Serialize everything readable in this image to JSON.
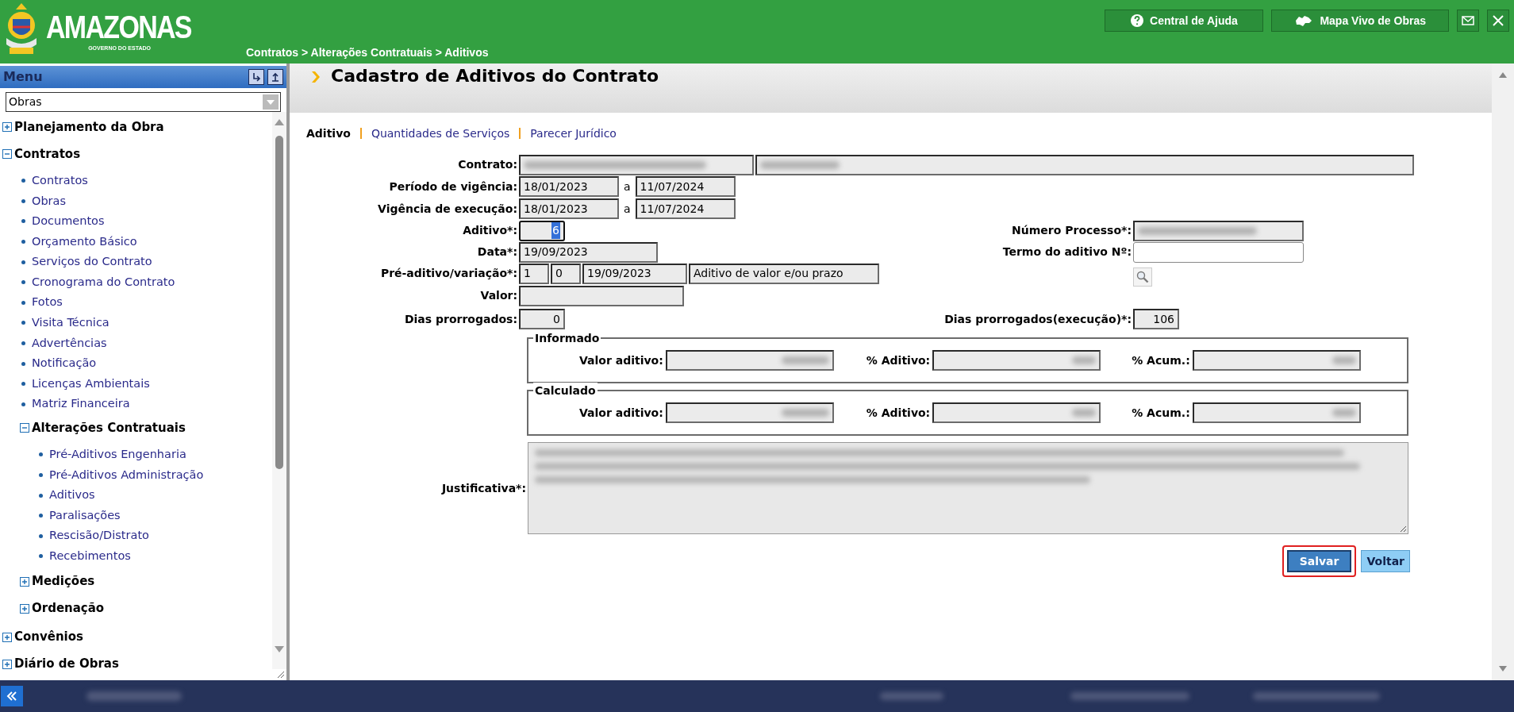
{
  "header": {
    "brand": "AMAZONAS",
    "subtitle": "GOVERNO DO ESTADO",
    "breadcrumb": "Contratos > Alterações Contratuais > Aditivos",
    "buttons": [
      {
        "kind": "help",
        "label": "Central de Ajuda"
      },
      {
        "kind": "map",
        "label": "Mapa Vivo de Obras"
      },
      {
        "kind": "mail"
      },
      {
        "kind": "close"
      }
    ]
  },
  "sidebar": {
    "title": "Menu",
    "module_select": {
      "value": "Obras"
    },
    "tree": [
      {
        "kind": "group",
        "label": "Planejamento da Obra",
        "expanded": false
      },
      {
        "kind": "group",
        "label": "Contratos",
        "expanded": true,
        "children": [
          {
            "kind": "link",
            "label": "Contratos"
          },
          {
            "kind": "link",
            "label": "Obras"
          },
          {
            "kind": "link",
            "label": "Documentos"
          },
          {
            "kind": "link",
            "label": "Orçamento Básico"
          },
          {
            "kind": "link",
            "label": "Serviços do Contrato"
          },
          {
            "kind": "link",
            "label": "Cronograma do Contrato"
          },
          {
            "kind": "link",
            "label": "Fotos"
          },
          {
            "kind": "link",
            "label": "Visita Técnica"
          },
          {
            "kind": "link",
            "label": "Advertências"
          },
          {
            "kind": "link",
            "label": "Notificação"
          },
          {
            "kind": "link",
            "label": "Licenças Ambientais"
          },
          {
            "kind": "link",
            "label": "Matriz Financeira"
          },
          {
            "kind": "group",
            "label": "Alterações Contratuais",
            "expanded": true,
            "children": [
              {
                "kind": "link",
                "label": "Pré-Aditivos Engenharia"
              },
              {
                "kind": "link",
                "label": "Pré-Aditivos Administração"
              },
              {
                "kind": "link",
                "label": "Aditivos"
              },
              {
                "kind": "link",
                "label": "Paralisações"
              },
              {
                "kind": "link",
                "label": "Rescisão/Distrato"
              },
              {
                "kind": "link",
                "label": "Recebimentos"
              }
            ]
          },
          {
            "kind": "group",
            "label": "Medições",
            "expanded": false
          },
          {
            "kind": "group",
            "label": "Ordenação",
            "expanded": false
          }
        ]
      },
      {
        "kind": "group",
        "label": "Convênios",
        "expanded": false
      },
      {
        "kind": "group",
        "label": "Diário de Obras",
        "expanded": false
      }
    ]
  },
  "page": {
    "title": "Cadastro de Aditivos do Contrato",
    "tabs": [
      {
        "label": "Aditivo",
        "selected": true
      },
      {
        "label": "Quantidades de Serviços",
        "selected": false
      },
      {
        "label": "Parecer Jurídico",
        "selected": false
      }
    ],
    "form": {
      "contrato": {
        "label": "Contrato:"
      },
      "periodo_vigencia": {
        "label": "Período de vigência:",
        "start": "18/01/2023",
        "separator": "a",
        "end": "11/07/2024"
      },
      "vigencia_execucao": {
        "label": "Vigência de execução:",
        "start": "18/01/2023",
        "separator": "a",
        "end": "11/07/2024"
      },
      "aditivo": {
        "label": "Aditivo*:",
        "value": "6",
        "focused": true
      },
      "numero_processo": {
        "label": "Número Processo*:"
      },
      "data": {
        "label": "Data*:",
        "value": "19/09/2023"
      },
      "termo_aditivo": {
        "label": "Termo do aditivo Nº:"
      },
      "pre_aditivo": {
        "label": "Pré-aditivo/variação*:",
        "values": [
          "1",
          "0",
          "19/09/2023",
          "Aditivo de valor e/ou prazo"
        ]
      },
      "valor": {
        "label": "Valor:"
      },
      "dias_prorrogados": {
        "label": "Dias prorrogados:",
        "value": "0"
      },
      "dias_prorrogados_execucao": {
        "label": "Dias prorrogados(execução)*:",
        "value": "106"
      },
      "fieldsets": [
        {
          "legend": "Informado",
          "fields": [
            {
              "label": "Valor aditivo:"
            },
            {
              "label": "% Aditivo:"
            },
            {
              "label": "% Acum.:"
            }
          ]
        },
        {
          "legend": "Calculado",
          "fields": [
            {
              "label": "Valor aditivo:"
            },
            {
              "label": "% Aditivo:"
            },
            {
              "label": "% Acum.:"
            }
          ]
        }
      ],
      "justificativa": {
        "label": "Justificativa*:"
      },
      "actions": [
        {
          "kind": "primary",
          "label": "Salvar",
          "highlighted": true
        },
        {
          "kind": "secondary",
          "label": "Voltar",
          "highlighted": false
        }
      ]
    }
  }
}
